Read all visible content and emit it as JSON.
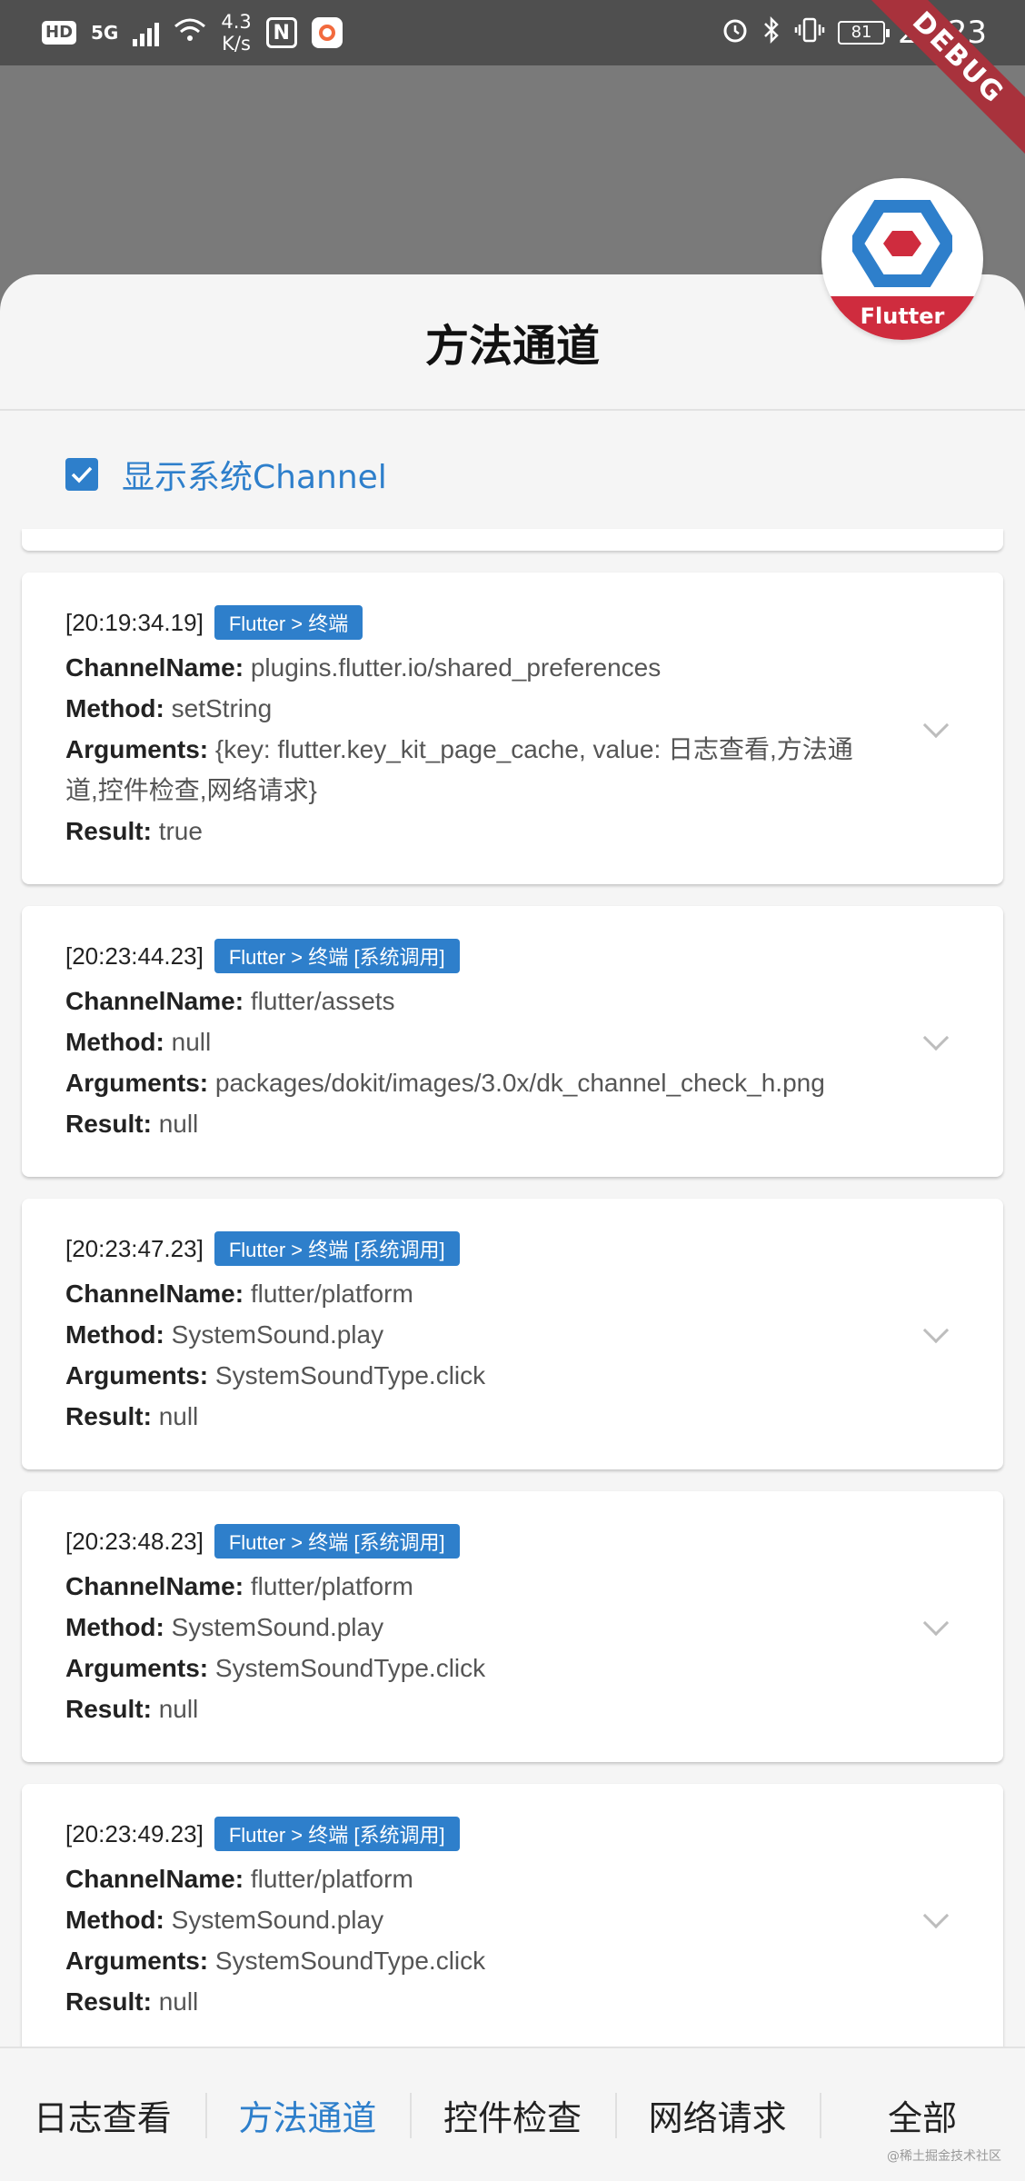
{
  "status_bar": {
    "hd": "HD",
    "network": "5G",
    "speed_value": "4.3",
    "speed_unit": "K/s",
    "nfc": "N",
    "battery": "81",
    "time": "20:23"
  },
  "debug_banner": "DEBUG",
  "logo": {
    "label": "Flutter"
  },
  "header": {
    "title": "方法通道"
  },
  "filter": {
    "checked": true,
    "label": "显示系统Channel"
  },
  "field_labels": {
    "channel": "ChannelName:",
    "method": "Method:",
    "arguments": "Arguments:",
    "result": "Result:"
  },
  "entries": [
    {
      "time": "[20:19:34.19]",
      "tag": "Flutter > 终端",
      "channel": "plugins.flutter.io/shared_preferences",
      "method": "setString",
      "arguments": "{key: flutter.key_kit_page_cache, value: 日志查看,方法通道,控件检查,网络请求}",
      "result": "true"
    },
    {
      "time": "[20:23:44.23]",
      "tag": "Flutter > 终端 [系统调用]",
      "channel": "flutter/assets",
      "method": "null",
      "arguments": "packages/dokit/images/3.0x/dk_channel_check_h.png",
      "result": "null"
    },
    {
      "time": "[20:23:47.23]",
      "tag": "Flutter > 终端 [系统调用]",
      "channel": "flutter/platform",
      "method": "SystemSound.play",
      "arguments": "SystemSoundType.click",
      "result": "null"
    },
    {
      "time": "[20:23:48.23]",
      "tag": "Flutter > 终端 [系统调用]",
      "channel": "flutter/platform",
      "method": "SystemSound.play",
      "arguments": "SystemSoundType.click",
      "result": "null"
    },
    {
      "time": "[20:23:49.23]",
      "tag": "Flutter > 终端 [系统调用]",
      "channel": "flutter/platform",
      "method": "SystemSound.play",
      "arguments": "SystemSoundType.click",
      "result": "null"
    }
  ],
  "tabs": [
    "日志查看",
    "方法通道",
    "控件检查",
    "网络请求",
    "全部"
  ],
  "active_tab": 1,
  "watermark": "@稀土掘金技术社区",
  "colors": {
    "accent": "#2e7fcb",
    "status_bar": "#4f4f4f",
    "debug": "#a8323c",
    "logo_red": "#cf2c3e"
  }
}
